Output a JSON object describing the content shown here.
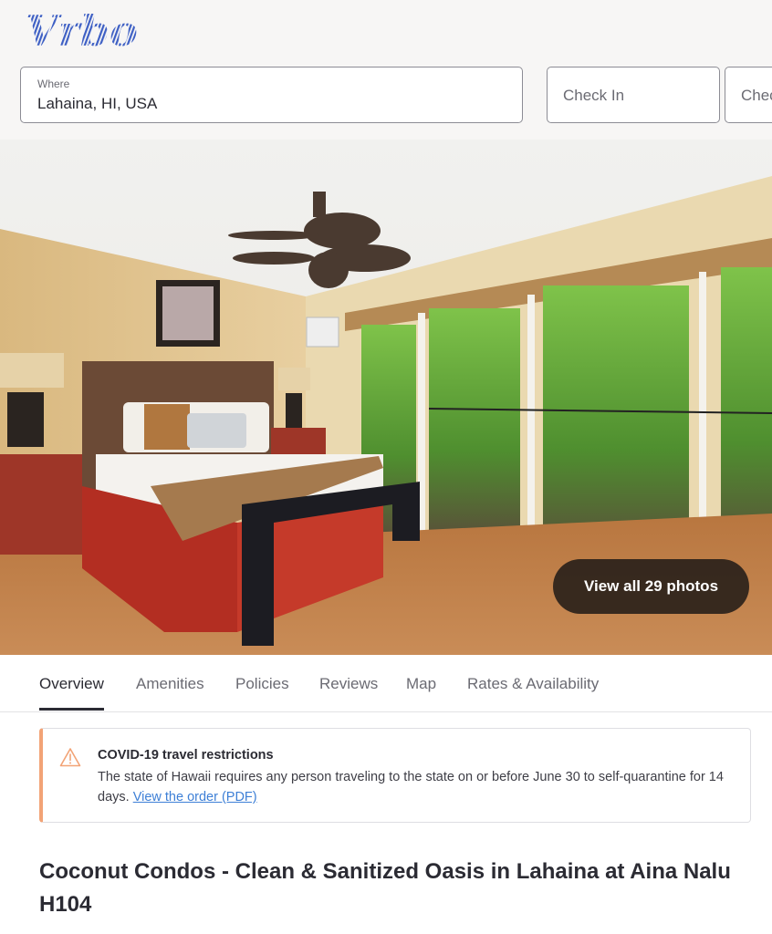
{
  "brand": {
    "name": "Vrbo",
    "color": "#3d5fc4"
  },
  "search": {
    "where_label": "Where",
    "where_value": "Lahaina, HI, USA",
    "checkin_placeholder": "Check In",
    "checkout_placeholder": "Check Out"
  },
  "gallery": {
    "view_all_label": "View all 29 photos",
    "photo_count": 29,
    "photo_description": "Bedroom with queen bed, ceiling fan, and floor-to-ceiling windows facing palm trees"
  },
  "tabs": [
    {
      "label": "Overview",
      "active": true
    },
    {
      "label": "Amenities",
      "active": false
    },
    {
      "label": "Policies",
      "active": false
    },
    {
      "label": "Reviews",
      "active": false
    },
    {
      "label": "Map",
      "active": false
    },
    {
      "label": "Rates & Availability",
      "active": false
    }
  ],
  "alert": {
    "icon": "warning-icon",
    "accent_color": "#f2a376",
    "title": "COVID-19 travel restrictions",
    "body": "The state of Hawaii requires any person traveling to the state on or before June 30 to self-quarantine for 14 days. ",
    "link_label": "View the order (PDF)"
  },
  "listing": {
    "title": "Coconut Condos - Clean & Sanitized Oasis in Lahaina at Aina Nalu H104"
  }
}
